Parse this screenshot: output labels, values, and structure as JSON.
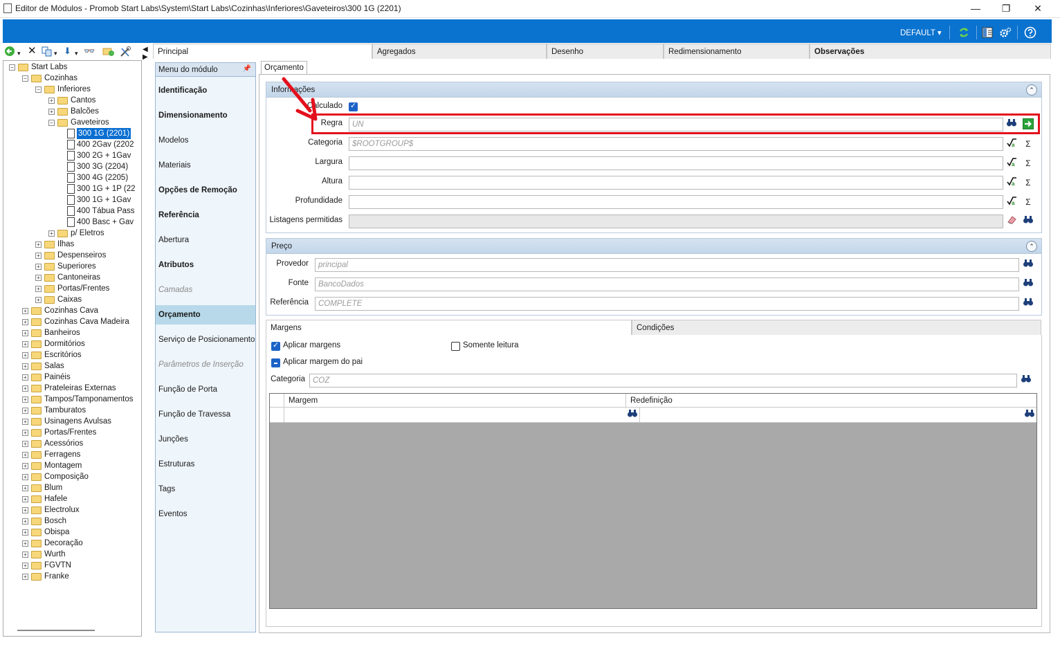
{
  "window": {
    "title": "Editor de Módulos - Promob Start Labs\\System\\Start Labs\\Cozinhas\\Inferiores\\Gaveteiros\\300 1G (2201)",
    "minimize": "—",
    "maximize": "❐",
    "close": "✕"
  },
  "ribbon": {
    "profile": "DEFAULT ▾",
    "icons": [
      "refresh-icon",
      "layout-icon",
      "settings-icon",
      "help-icon"
    ]
  },
  "tree": {
    "items": [
      {
        "label": "Start Labs"
      },
      {
        "label": "Cozinhas"
      },
      {
        "label": "Inferiores"
      },
      {
        "label": "Cantos"
      },
      {
        "label": "Balcões"
      },
      {
        "label": "Gaveteiros"
      },
      {
        "label": "300 1G (2201)"
      },
      {
        "label": "400 2Gav (2202"
      },
      {
        "label": "300 2G + 1Gav"
      },
      {
        "label": "300 3G (2204)"
      },
      {
        "label": "300 4G (2205)"
      },
      {
        "label": "300 1G + 1P (22"
      },
      {
        "label": "300 1G + 1Gav"
      },
      {
        "label": "400 Tábua Pass"
      },
      {
        "label": "400 Basc + Gav"
      },
      {
        "label": "p/ Eletros"
      },
      {
        "label": "Ilhas"
      },
      {
        "label": "Despenseiros"
      },
      {
        "label": "Superiores"
      },
      {
        "label": "Cantoneiras"
      },
      {
        "label": "Portas/Frentes"
      },
      {
        "label": "Caixas"
      },
      {
        "label": "Cozinhas Cava"
      },
      {
        "label": "Cozinhas Cava Madeira"
      },
      {
        "label": "Banheiros"
      },
      {
        "label": "Dormitórios"
      },
      {
        "label": "Escritórios"
      },
      {
        "label": "Salas"
      },
      {
        "label": "Painéis"
      },
      {
        "label": "Prateleiras Externas"
      },
      {
        "label": "Tampos/Tamponamentos"
      },
      {
        "label": "Tamburatos"
      },
      {
        "label": "Usinagens Avulsas"
      },
      {
        "label": "Portas/Frentes"
      },
      {
        "label": "Acessórios"
      },
      {
        "label": "Ferragens"
      },
      {
        "label": "Montagem"
      },
      {
        "label": "Composição"
      },
      {
        "label": "Blum"
      },
      {
        "label": "Hafele"
      },
      {
        "label": "Electrolux"
      },
      {
        "label": "Bosch"
      },
      {
        "label": "Obispa"
      },
      {
        "label": "Decoração"
      },
      {
        "label": "Wurth"
      },
      {
        "label": "FGVTN"
      },
      {
        "label": "Franke"
      }
    ]
  },
  "tabs": [
    "Principal",
    "Agregados",
    "Desenho",
    "Redimensionamento",
    "Observações"
  ],
  "menu": {
    "title": "Menu do módulo",
    "items": [
      "Identificação",
      "Dimensionamento",
      "Modelos",
      "Materiais",
      "Opções de Remoção",
      "Referência",
      "Abertura",
      "Atributos",
      "Camadas",
      "Orçamento",
      "Serviço de Posicionamento",
      "Parâmetros de Inserção",
      "Função de Porta",
      "Função de Travessa",
      "Junções",
      "Estruturas",
      "Tags",
      "Eventos"
    ]
  },
  "subtab": "Orçamento",
  "info": {
    "title": "Informações",
    "calculado": "Calculado",
    "regra_label": "Regra",
    "regra_value": "UN",
    "categoria_label": "Categoria",
    "categoria_value": "$ROOTGROUP$",
    "largura_label": "Largura",
    "altura_label": "Altura",
    "profundidade_label": "Profundidade",
    "listagens_label": "Listagens permitidas"
  },
  "preco": {
    "title": "Preço",
    "provedor_label": "Provedor",
    "provedor_value": "principal",
    "fonte_label": "Fonte",
    "fonte_value": "BancoDados",
    "referencia_label": "Referência",
    "referencia_value": "COMPLETE"
  },
  "margens": {
    "tab_margens": "Margens",
    "tab_condicoes": "Condições",
    "aplicar_margens": "Aplicar margens",
    "somente_leitura": "Somente leitura",
    "aplicar_margem_pai": "Aplicar margem do pai",
    "categoria_label": "Categoria",
    "categoria_value": "COZ",
    "col_margem": "Margem",
    "col_redefinicao": "Redefinição"
  },
  "colors": {
    "ribbon": "#0a72cf",
    "selection": "#0a6fd1",
    "highlight": "#e3101c",
    "menu_active": "#b7d9e9"
  }
}
